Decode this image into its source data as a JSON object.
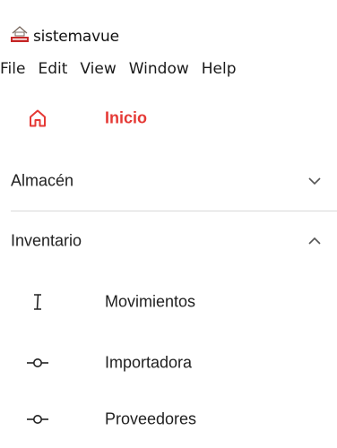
{
  "window": {
    "title": "sistemavue",
    "app_icon": "app-logo-icon"
  },
  "menubar": {
    "items": [
      "File",
      "Edit",
      "View",
      "Window",
      "Help"
    ]
  },
  "nav": {
    "home": {
      "label": "Inicio",
      "icon": "home-icon",
      "active": true,
      "color": "#e53935"
    },
    "groups": [
      {
        "label": "Almacén",
        "expanded": false,
        "icon": "chevron-down-icon"
      },
      {
        "label": "Inventario",
        "expanded": true,
        "icon": "chevron-up-icon"
      }
    ],
    "items": [
      {
        "label": "Movimientos",
        "icon": "text-cursor-icon"
      },
      {
        "label": "Importadora",
        "icon": "commit-icon"
      },
      {
        "label": "Proveedores",
        "icon": "commit-icon"
      }
    ]
  },
  "colors": {
    "accent": "#e53935",
    "text": "#1f1f1f",
    "divider": "#d9d9d9"
  }
}
